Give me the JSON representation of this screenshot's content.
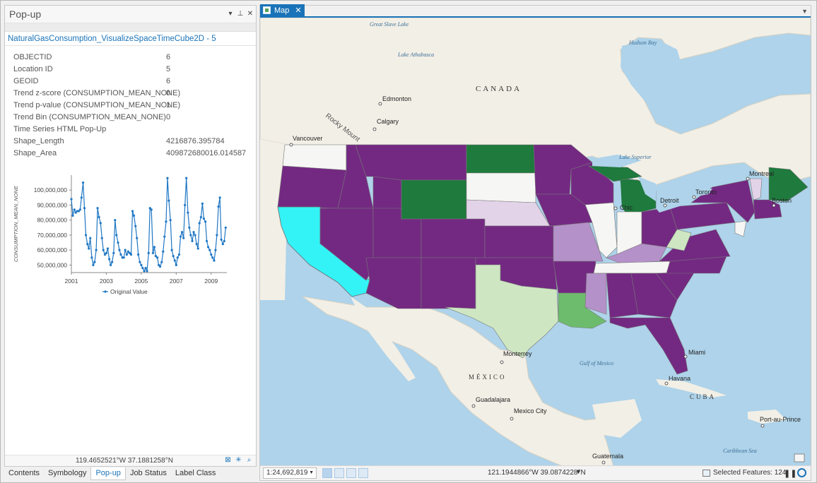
{
  "popup": {
    "title": "Pop-up",
    "feature_title": "NaturalGasConsumption_VisualizeSpaceTimeCube2D - 5",
    "attributes": [
      {
        "key": "OBJECTID",
        "value": "6"
      },
      {
        "key": "Location ID",
        "value": "5"
      },
      {
        "key": "GEOID",
        "value": "6"
      },
      {
        "key": "Trend z-score (CONSUMPTION_MEAN_NONE)",
        "value": "0"
      },
      {
        "key": "Trend p-value (CONSUMPTION_MEAN_NONE)",
        "value": "1"
      },
      {
        "key": "Trend Bin (CONSUMPTION_MEAN_NONE)",
        "value": "0"
      },
      {
        "key": "Time Series HTML Pop-Up",
        "value": ""
      },
      {
        "key": "Shape_Length",
        "value": "4216876.395784"
      },
      {
        "key": "Shape_Area",
        "value": "409872680016.014587"
      }
    ],
    "coordinates": "119.4652521°W 37.1881258°N"
  },
  "bottom_tabs": [
    "Contents",
    "Symbology",
    "Pop-up",
    "Job Status",
    "Label Class"
  ],
  "active_bottom_tab": "Pop-up",
  "chart_data": {
    "type": "line",
    "title": "",
    "xlabel": "",
    "ylabel": "CONSUMPTION_MEAN_NONE",
    "ylim": [
      45000000,
      110000000
    ],
    "xlim": [
      2001,
      2009.9
    ],
    "y_ticks": [
      "50,000,000",
      "60,000,000",
      "70,000,000",
      "80,000,000",
      "90,000,000",
      "100,000,000"
    ],
    "x_ticks": [
      "2001",
      "2003",
      "2005",
      "2007",
      "2009"
    ],
    "legend": "bottom",
    "color": "#1f77c4",
    "series": [
      {
        "name": "Original Value",
        "x": [
          2001.0,
          2001.08,
          2001.17,
          2001.25,
          2001.33,
          2001.42,
          2001.5,
          2001.58,
          2001.67,
          2001.75,
          2001.83,
          2001.92,
          2002.0,
          2002.08,
          2002.17,
          2002.25,
          2002.33,
          2002.42,
          2002.5,
          2002.58,
          2002.67,
          2002.75,
          2002.83,
          2002.92,
          2003.0,
          2003.08,
          2003.17,
          2003.25,
          2003.33,
          2003.42,
          2003.5,
          2003.58,
          2003.67,
          2003.75,
          2003.83,
          2003.92,
          2004.0,
          2004.08,
          2004.17,
          2004.25,
          2004.33,
          2004.42,
          2004.5,
          2004.58,
          2004.67,
          2004.75,
          2004.83,
          2004.92,
          2005.0,
          2005.08,
          2005.17,
          2005.25,
          2005.33,
          2005.42,
          2005.5,
          2005.58,
          2005.67,
          2005.75,
          2005.83,
          2005.92,
          2006.0,
          2006.08,
          2006.17,
          2006.25,
          2006.33,
          2006.42,
          2006.5,
          2006.58,
          2006.67,
          2006.75,
          2006.83,
          2006.92,
          2007.0,
          2007.08,
          2007.17,
          2007.25,
          2007.33,
          2007.42,
          2007.5,
          2007.58,
          2007.67,
          2007.75,
          2007.83,
          2007.92,
          2008.0,
          2008.08,
          2008.17,
          2008.25,
          2008.33,
          2008.42,
          2008.5,
          2008.58,
          2008.67,
          2008.75,
          2008.83,
          2008.92,
          2009.0,
          2009.08,
          2009.17,
          2009.25,
          2009.33,
          2009.42,
          2009.5,
          2009.58,
          2009.67,
          2009.75,
          2009.83
        ],
        "values": [
          94000000,
          83000000,
          87000000,
          85000000,
          86000000,
          86000000,
          87000000,
          95000000,
          105000000,
          88000000,
          70000000,
          64000000,
          61000000,
          68000000,
          55000000,
          50000000,
          52000000,
          60000000,
          88000000,
          82000000,
          78000000,
          68000000,
          60000000,
          57000000,
          58000000,
          61000000,
          54000000,
          50000000,
          52000000,
          58000000,
          80000000,
          70000000,
          65000000,
          60000000,
          57000000,
          55000000,
          55000000,
          60000000,
          57000000,
          59000000,
          58000000,
          57000000,
          86000000,
          83000000,
          76000000,
          68000000,
          57000000,
          52000000,
          50000000,
          48000000,
          46000000,
          48000000,
          46000000,
          58000000,
          88000000,
          87000000,
          58000000,
          62000000,
          56000000,
          55000000,
          50000000,
          49000000,
          52000000,
          59000000,
          69000000,
          79000000,
          108000000,
          93000000,
          80000000,
          60000000,
          56000000,
          53000000,
          50000000,
          55000000,
          57000000,
          69000000,
          72000000,
          68000000,
          90000000,
          108000000,
          85000000,
          75000000,
          70000000,
          66000000,
          72000000,
          70000000,
          64000000,
          61000000,
          78000000,
          82000000,
          91000000,
          81000000,
          79000000,
          66000000,
          62000000,
          60000000,
          57000000,
          55000000,
          53000000,
          60000000,
          70000000,
          89000000,
          95000000,
          67000000,
          64000000,
          66000000,
          75000000
        ]
      }
    ]
  },
  "map": {
    "tab_label": "Map",
    "scale": "1:24,692,819",
    "coordinates": "121.1944866°W 39.0874228°N",
    "selected_features": "Selected Features: 124",
    "labels": {
      "canada": "CANADA",
      "mexico": "MÉXICO",
      "cuba": "CUBA",
      "great_slave_lake": "Great Slave Lake",
      "lake_athabasca": "Lake Athabasca",
      "hudson_bay": "Hudson Bay",
      "lake_superior": "Lake Superior",
      "gulf_of_mexico": "Gulf of Mexico",
      "caribbean_sea": "Caribbean Sea",
      "rocky_mount": "Rocky Mount",
      "edmonton": "Edmonton",
      "calgary": "Calgary",
      "vancouver": "Vancouver",
      "montreal": "Montreal",
      "toronto": "Toronto",
      "detroit": "Detroit",
      "chicago": "Chic",
      "boston": "Boston",
      "miami": "Miami",
      "havana": "Havana",
      "monterrey": "Monterrey",
      "guadalajara": "Guadalajara",
      "mexico_city": "Mexico City",
      "guatemala": "Guatemala",
      "port_au_prince": "Port-au-Prince"
    },
    "colors": {
      "purple": "#732982",
      "green": "#1e7a3d",
      "light_green": "#6dbb6d",
      "pale_green": "#cfe6c3",
      "light_purple": "#b491c8",
      "lavender": "#e3d3e8",
      "neutral": "#f6f6f4",
      "selected": "#33f3f7",
      "land": "#f2efe6",
      "water": "#aed3ea"
    }
  }
}
